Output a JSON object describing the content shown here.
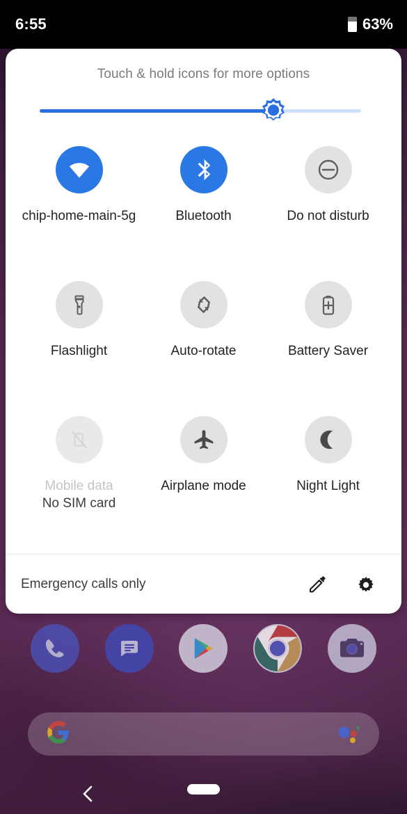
{
  "status_bar": {
    "clock": "6:55",
    "battery_percent": "63%",
    "battery_icon": "battery-icon"
  },
  "quick_settings": {
    "hint": "Touch & hold icons for more options",
    "brightness": {
      "icon": "brightness-sun-icon",
      "value_percent": 72,
      "track_color": "#cfe0fb",
      "fill_color": "#2a6fe0"
    },
    "tiles": [
      {
        "id": "wifi",
        "label": "chip-home-main-5g",
        "sub": "",
        "icon": "wifi-icon",
        "state": "active"
      },
      {
        "id": "bluetooth",
        "label": "Bluetooth",
        "sub": "",
        "icon": "bluetooth-icon",
        "state": "active"
      },
      {
        "id": "dnd",
        "label": "Do not disturb",
        "sub": "",
        "icon": "do-not-disturb-icon",
        "state": "inactive"
      },
      {
        "id": "flashlight",
        "label": "Flashlight",
        "sub": "",
        "icon": "flashlight-icon",
        "state": "inactive"
      },
      {
        "id": "auto-rotate",
        "label": "Auto-rotate",
        "sub": "",
        "icon": "auto-rotate-icon",
        "state": "inactive"
      },
      {
        "id": "battery-saver",
        "label": "Battery Saver",
        "sub": "",
        "icon": "battery-saver-icon",
        "state": "inactive"
      },
      {
        "id": "mobile-data",
        "label": "Mobile data",
        "sub": "No SIM card",
        "icon": "mobile-data-off-icon",
        "state": "disabled"
      },
      {
        "id": "airplane-mode",
        "label": "Airplane mode",
        "sub": "",
        "icon": "airplane-icon",
        "state": "inactive"
      },
      {
        "id": "night-light",
        "label": "Night Light",
        "sub": "",
        "icon": "moon-icon",
        "state": "inactive"
      }
    ],
    "footer": {
      "carrier_status": "Emergency calls only",
      "edit_icon": "pencil-icon",
      "settings_icon": "gear-icon"
    },
    "accent_color": "#2a78e4",
    "inactive_color": "#e2e2e2"
  },
  "dock": {
    "apps": [
      {
        "id": "phone",
        "icon": "phone-icon"
      },
      {
        "id": "messages",
        "icon": "messages-icon"
      },
      {
        "id": "play-store",
        "icon": "play-store-icon"
      },
      {
        "id": "chrome",
        "icon": "chrome-icon"
      },
      {
        "id": "camera",
        "icon": "camera-icon"
      }
    ]
  },
  "search_bar": {
    "logo_icon": "google-g-icon",
    "assistant_icon": "google-assistant-icon",
    "query": ""
  },
  "nav_bar": {
    "back_icon": "back-chevron-icon",
    "home_icon": "home-pill-icon"
  }
}
